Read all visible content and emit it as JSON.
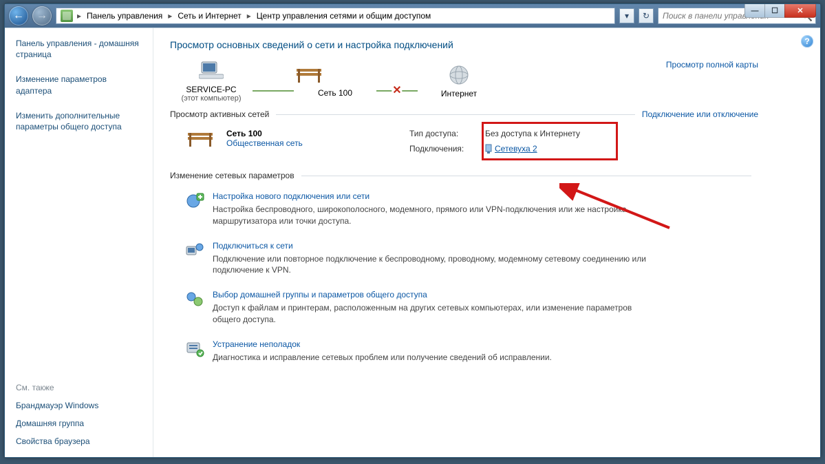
{
  "window": {
    "min": "—",
    "max": "☐",
    "close": "✕"
  },
  "nav": {
    "back": "←",
    "forward": "→"
  },
  "breadcrumb": {
    "root_arrow": "▸",
    "seg1": "Панель управления",
    "seg2": "Сеть и Интернет",
    "seg3": "Центр управления сетями и общим доступом"
  },
  "toolbar": {
    "dropdown": "▾",
    "refresh": "↻"
  },
  "search": {
    "placeholder": "Поиск в панели управления"
  },
  "sidebar": {
    "home": "Панель управления - домашняя страница",
    "link1": "Изменение параметров адаптера",
    "link2": "Изменить дополнительные параметры общего доступа",
    "see_also_label": "См. также",
    "see1": "Брандмауэр Windows",
    "see2": "Домашняя группа",
    "see3": "Свойства браузера"
  },
  "main": {
    "title": "Просмотр основных сведений о сети и настройка подключений",
    "view_full_map": "Просмотр полной карты",
    "nodes": {
      "pc": "SERVICE-PC",
      "pc_sub": "(этот компьютер)",
      "net": "Сеть  100",
      "internet": "Интернет"
    },
    "active_label": "Просмотр активных сетей",
    "connect_disconnect": "Подключение или отключение",
    "active": {
      "name": "Сеть  100",
      "type_link": "Общественная сеть",
      "k_access": "Тип доступа:",
      "v_access": "Без доступа к Интернету",
      "k_conn": "Подключения:",
      "v_conn": "Сетевуха 2"
    },
    "change_label": "Изменение сетевых параметров",
    "items": {
      "new_conn_title": "Настройка нового подключения или сети",
      "new_conn_desc": "Настройка беспроводного, широкополосного, модемного, прямого или VPN-подключения или же настройка маршрутизатора или точки доступа.",
      "connect_title": "Подключиться к сети",
      "connect_desc": "Подключение или повторное подключение к беспроводному, проводному, модемному сетевому соединению или подключение к VPN.",
      "homegroup_title": "Выбор домашней группы и параметров общего доступа",
      "homegroup_desc": "Доступ к файлам и принтерам, расположенным на других сетевых компьютерах, или изменение параметров общего доступа.",
      "troubleshoot_title": "Устранение неполадок",
      "troubleshoot_desc": "Диагностика и исправление сетевых проблем или получение сведений об исправлении."
    }
  },
  "help": "?"
}
